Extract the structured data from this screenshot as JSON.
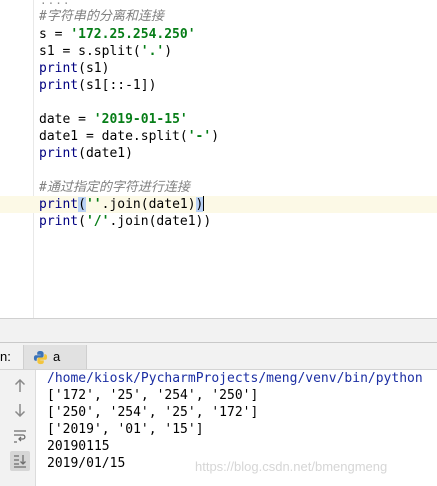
{
  "editor": {
    "fold_marker": "····",
    "lines": {
      "l1": "#字符串的分离和连接",
      "l2a": "s = ",
      "l2b": "'172.25.254.250'",
      "l3a": "s1 = s.split(",
      "l3b": "'.'",
      "l3c": ")",
      "l4a": "print",
      "l4b": "(s1)",
      "l5a": "print",
      "l5b": "(s1[::-1])",
      "l7a": "date = ",
      "l7b": "'2019-01-15'",
      "l8a": "date1 = date.split(",
      "l8b": "'-'",
      "l8c": ")",
      "l9a": "print",
      "l9b": "(date1)",
      "l11": "#通过指定的字符进行连接",
      "l12a": "print",
      "l12b": "(",
      "l12c": "''",
      "l12d": ".join(date1)",
      "l12e": ")",
      "l13a": "print",
      "l13b": "(",
      "l13c": "'/'",
      "l13d": ".join(date1))"
    }
  },
  "run": {
    "label": "n:",
    "tab_label": "a"
  },
  "console": {
    "lines": [
      "/home/kiosk/PycharmProjects/meng/venv/bin/python",
      "['172', '25', '254', '250']",
      "['250', '254', '25', '172']",
      "['2019', '01', '15']",
      "20190115",
      "2019/01/15"
    ],
    "watermark": "https://blog.csdn.net/bmengmeng"
  },
  "colors": {
    "string": "#067d17",
    "function": "#000080",
    "comment": "#808080",
    "caret_line": "#fcf9e6",
    "brace_match": "#b9d1f5",
    "interpreter_path": "#1b2ea3"
  },
  "icons": {
    "run_tab": "python-icon",
    "toolbar": [
      "arrow-up-icon",
      "arrow-down-icon",
      "soft-wrap-icon",
      "scroll-to-end-icon"
    ]
  }
}
